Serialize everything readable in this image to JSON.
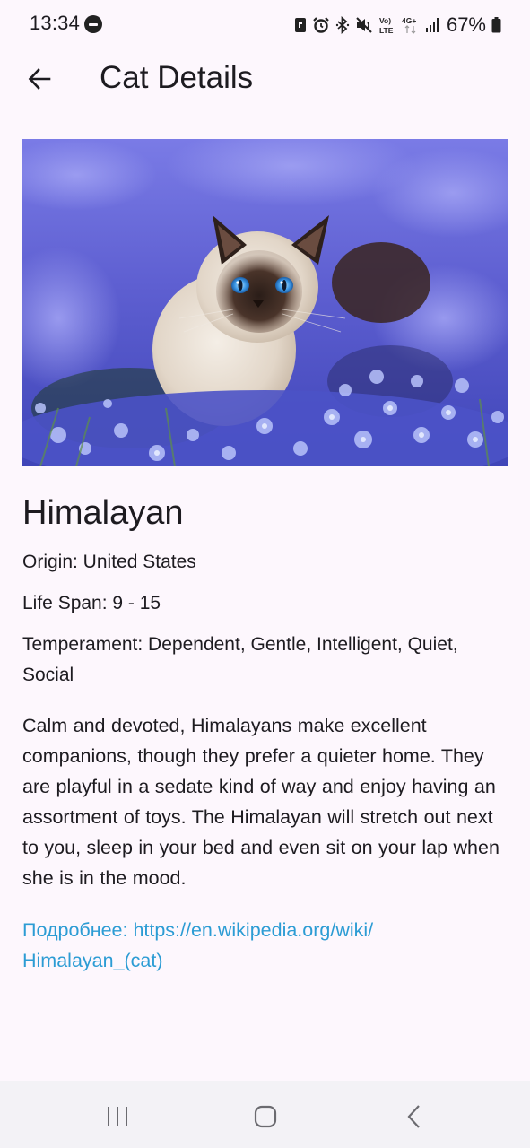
{
  "status_bar": {
    "time": "13:34",
    "battery_percent": "67%",
    "icons": [
      "dnd-icon",
      "nfc-icon",
      "alarm-icon",
      "bluetooth-icon",
      "mute-icon",
      "volte-icon",
      "4g-icon",
      "signal-icon",
      "battery-icon"
    ],
    "volte_label_top": "Vo)",
    "volte_label_bottom": "LTE",
    "network_label": "4G+"
  },
  "app_bar": {
    "title": "Cat Details",
    "back_icon": "arrow-back-icon"
  },
  "cat": {
    "image_alt": "Himalayan cat in a field of blue flowers",
    "name": "Himalayan",
    "origin": "Origin: United States",
    "life_span": "Life Span: 9 - 15",
    "temperament": "Temperament: Dependent, Gentle, Intelligent, Quiet, Social",
    "description": "Calm and devoted, Himalayans make excellent companions, though they prefer a quieter home. They are playful in a sedate kind of way and enjoy having an assortment of toys. The Himalayan will stretch out next to you, sleep in your bed and even sit on your lap when she is in the mood.",
    "more_link_line1": "Подробнее: https://en.wikipedia.org/wiki/",
    "more_link_line2": "Himalayan_(cat)"
  },
  "nav_bar": {
    "recents_icon": "recents-icon",
    "home_icon": "home-icon",
    "back_icon": "chevron-back-icon"
  },
  "colors": {
    "background": "#FDF7FD",
    "text": "#1D1B20",
    "link": "#2C9CD4",
    "nav_bar": "#F3F2F6"
  }
}
